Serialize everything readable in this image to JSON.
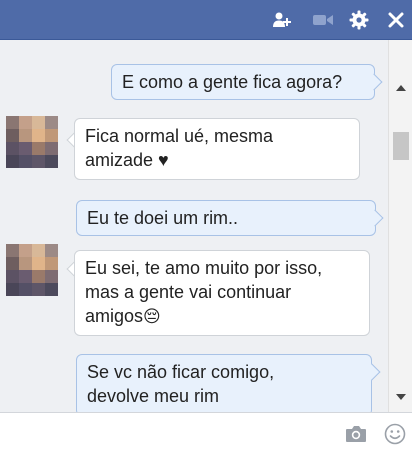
{
  "header": {
    "icons": [
      "add-friend-icon",
      "video-call-icon",
      "gear-icon",
      "close-icon"
    ],
    "color": "#4f6ba8"
  },
  "messages": [
    {
      "direction": "outgoing",
      "lines": [
        "E como a gente fica agora?"
      ]
    },
    {
      "direction": "incoming",
      "lines": [
        "Fica normal ué, mesma",
        "amizade ♥"
      ]
    },
    {
      "direction": "outgoing",
      "lines": [
        "Eu te doei um rim.."
      ]
    },
    {
      "direction": "incoming",
      "lines": [
        "Eu sei, te amo muito por isso,",
        "mas a gente vai continuar",
        "amigos"
      ],
      "emoji": "😔"
    },
    {
      "direction": "outgoing",
      "lines": [
        "Se vc não ficar comigo,",
        "devolve meu rim"
      ]
    }
  ],
  "composer": {
    "placeholder": "",
    "icons": [
      "camera-icon",
      "emoji-icon"
    ]
  }
}
